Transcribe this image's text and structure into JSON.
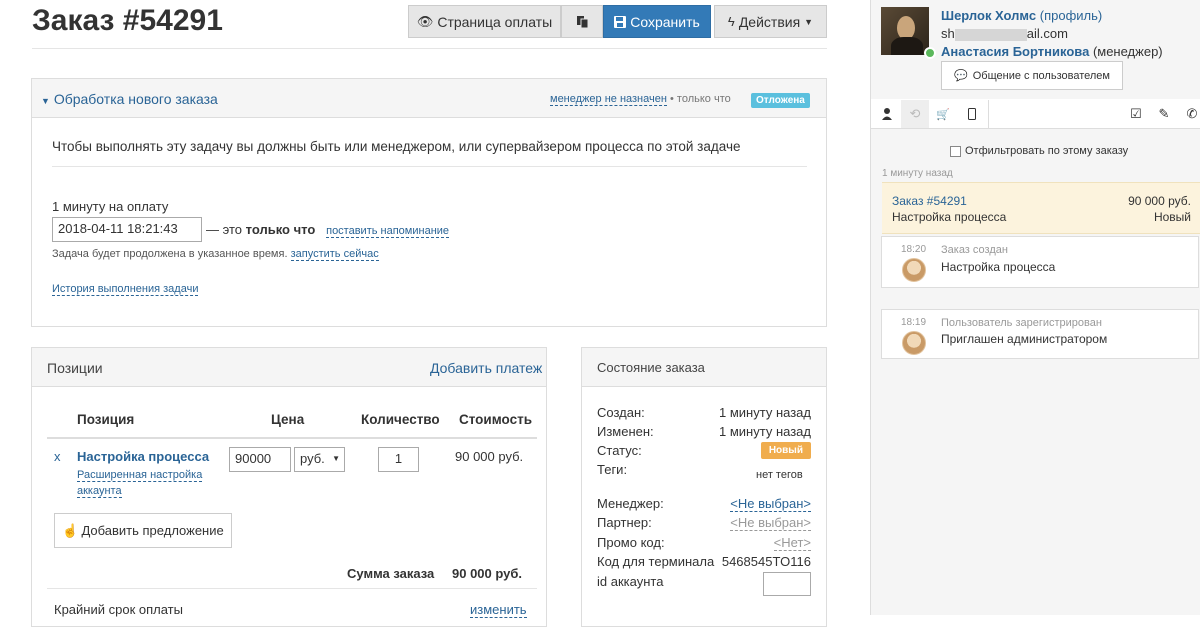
{
  "header": {
    "title": "Заказ #54291",
    "buttons": {
      "payment_page": "Страница оплаты",
      "save": "Сохранить",
      "actions": "Действия"
    }
  },
  "task": {
    "title": "Обработка нового заказа",
    "manager": "менеджер не назначен",
    "time": "• только что",
    "status": "Отложена",
    "notice": "Чтобы выполнять эту задачу вы должны быть или менеджером, или супервайзером процесса по этой задаче",
    "deadline_label": "1 минуту на оплату",
    "deadline_value": "2018-04-11 18:21:43",
    "deadline_sep": "— это",
    "deadline_rel": "только что",
    "reminder_link": "поставить напоминание",
    "continue_text": "Задача будет продолжена в указанное время.",
    "run_now_link": "запустить сейчас",
    "history_link": "История выполнения задачи"
  },
  "positions": {
    "title": "Позиции",
    "add_payment": "Добавить платеж",
    "columns": [
      "Позиция",
      "Цена",
      "Количество",
      "Стоимость"
    ],
    "items": [
      {
        "remove": "x",
        "name": "Настройка процесса",
        "desc_line1": "Расширенная настройка",
        "desc_line2": "аккаунта",
        "price": "90000",
        "currency": "руб.",
        "qty": "1",
        "total": "90 000 руб."
      }
    ],
    "add_offer": "Добавить предложение",
    "sum_label": "Сумма заказа",
    "sum_value": "90 000 руб.",
    "deadline_label": "Крайний срок оплаты",
    "deadline_change": "изменить"
  },
  "state": {
    "title": "Состояние заказа",
    "created_label": "Создан:",
    "created_value": "1 минуту назад",
    "changed_label": "Изменен:",
    "changed_value": "1 минуту назад",
    "status_label": "Статус:",
    "status_value": "Новый",
    "tags_label": "Теги:",
    "tags_value": "нет тегов",
    "manager_label": "Менеджер:",
    "manager_value": "<Не выбран>",
    "partner_label": "Партнер:",
    "partner_value": "<Не выбран>",
    "promo_label": "Промо код:",
    "promo_value": "<Нет>",
    "terminal_label": "Код для терминала",
    "terminal_value": "5468545TO116",
    "account_label": "id аккаунта",
    "account_value": ""
  },
  "sidebar": {
    "user_name": "Шерлок Холмс",
    "profile_link": "(профиль)",
    "email_start": "sh",
    "email_end": "ail.com",
    "manager_name": "Анастасия Бортникова",
    "manager_role": "(менеджер)",
    "chat_button": "Общение с пользователем",
    "filter_label": "Отфильтровать по этому заказу",
    "time_ago": "1 минуту назад",
    "order_card": {
      "title": "Заказ #54291",
      "amount": "90 000 руб.",
      "subtitle": "Настройка процесса",
      "status": "Новый"
    },
    "events": [
      {
        "time": "18:20",
        "title": "Заказ создан",
        "text": "Настройка процесса"
      },
      {
        "time": "18:19",
        "title": "Пользователь зарегистрирован",
        "text": "Приглашен администратором"
      }
    ],
    "tab_icons": [
      "user-icon",
      "history-icon",
      "cart-icon",
      "mobile-icon",
      "checkbox-icon",
      "pencil-icon",
      "phone-icon"
    ]
  },
  "colors": {
    "primary": "#337ab7",
    "info": "#5bc0de",
    "warning": "#f0ad4e",
    "highlight": "#fcf3dd",
    "online": "#5cb85c"
  }
}
